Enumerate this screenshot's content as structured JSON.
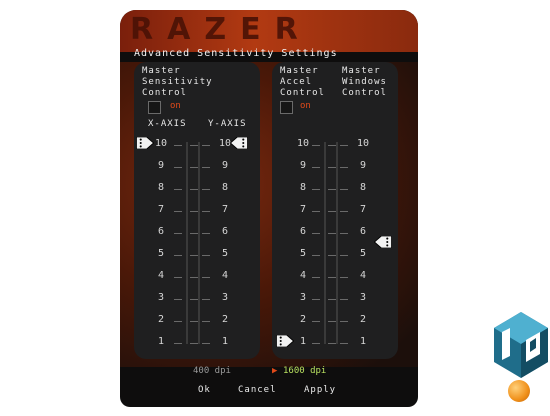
{
  "window": {
    "logo_text": "RAZER",
    "title": "Advanced Sensitivity Settings"
  },
  "left_panel": {
    "header": "Master\nSensitivity\nControl",
    "checkbox_label": "on",
    "x_label": "X-AXIS",
    "y_label": "Y-AXIS",
    "scale": [
      "10",
      "9",
      "8",
      "7",
      "6",
      "5",
      "4",
      "3",
      "2",
      "1"
    ],
    "x_value": 10,
    "y_value": 10
  },
  "right_panel": {
    "accel_header": "Master\nAccel\nControl",
    "windows_header": "Master\nWindows\nControl",
    "checkbox_label": "on",
    "scale": [
      "10",
      "9",
      "8",
      "7",
      "6",
      "5",
      "4",
      "3",
      "2",
      "1"
    ],
    "accel_value": 1,
    "windows_value": 5.5
  },
  "footer": {
    "dpi_400": "400 dpi",
    "dpi_1600": "1600 dpi",
    "ok": "Ok",
    "cancel": "Cancel",
    "apply": "Apply"
  },
  "colors": {
    "accent": "#e04a1a",
    "dpi_active": "#b8e060",
    "banner": "#b23a12"
  },
  "logo": {
    "brand": "LB",
    "icon": "cube-logo-icon"
  }
}
